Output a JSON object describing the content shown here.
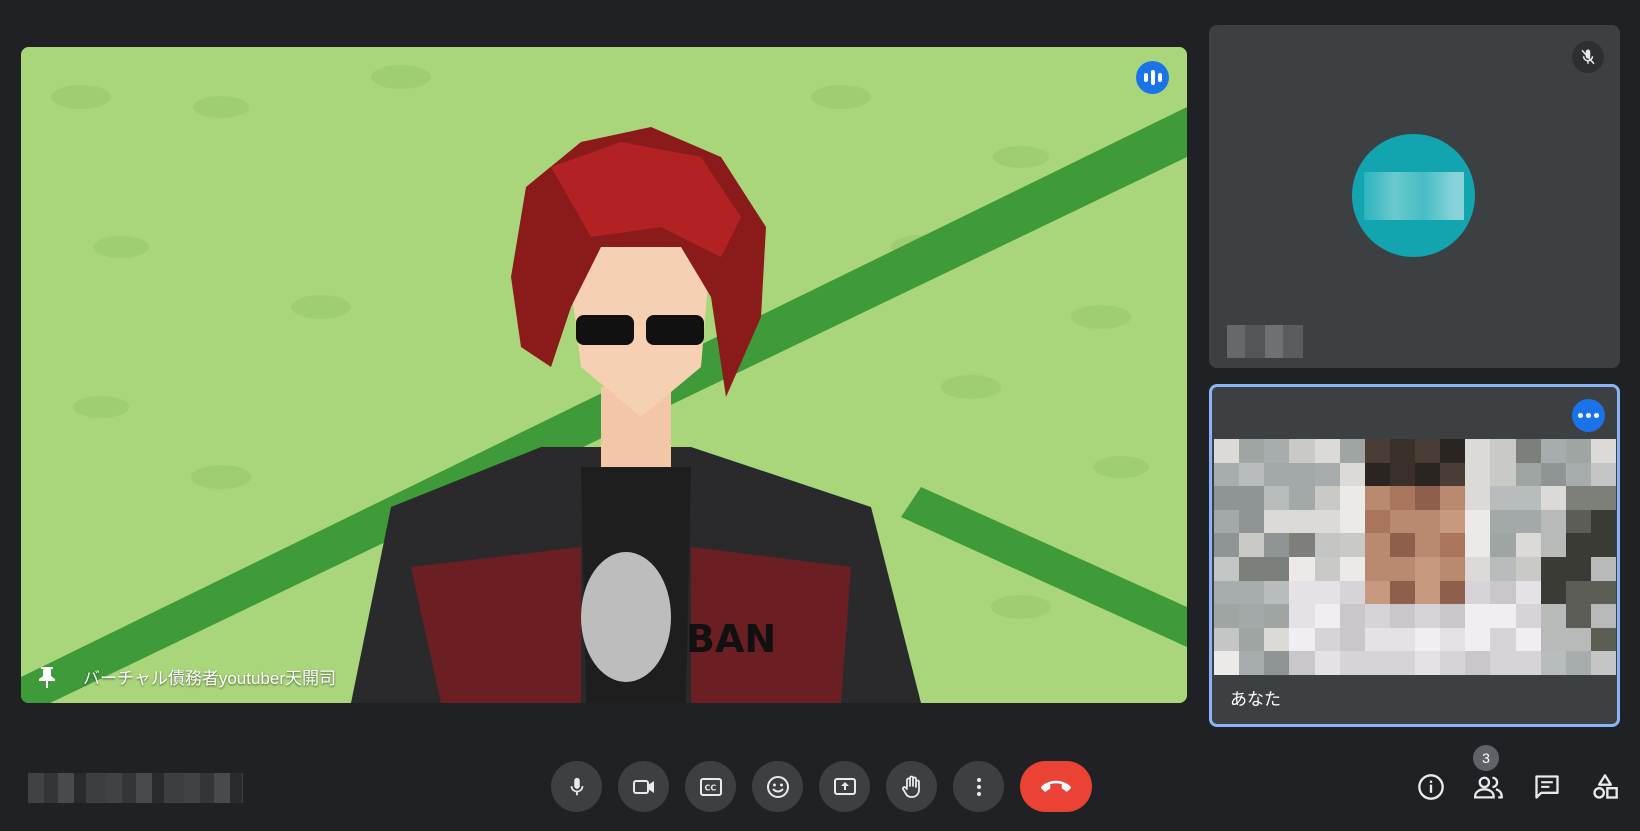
{
  "main_participant": {
    "name": "バーチャル債務者youtuber天開司",
    "shirt_text": "BAN"
  },
  "participants": [
    {
      "name": "",
      "avatar_color": "#12a4af",
      "muted": true
    },
    {
      "name": "あなた",
      "pinned_self": true
    }
  ],
  "toolbar": {
    "buttons": [
      "mic-icon",
      "camera-icon",
      "captions-icon",
      "emoji-icon",
      "present-icon",
      "hand-icon",
      "more-vert-icon",
      "end-call-icon"
    ],
    "right_buttons": [
      "info-icon",
      "people-icon",
      "chat-icon",
      "activities-icon"
    ],
    "people_count": "3"
  },
  "colors": {
    "accent": "#1a73e8",
    "end_call": "#ea4335",
    "tile_bg": "#3c4043",
    "page_bg": "#202124"
  }
}
